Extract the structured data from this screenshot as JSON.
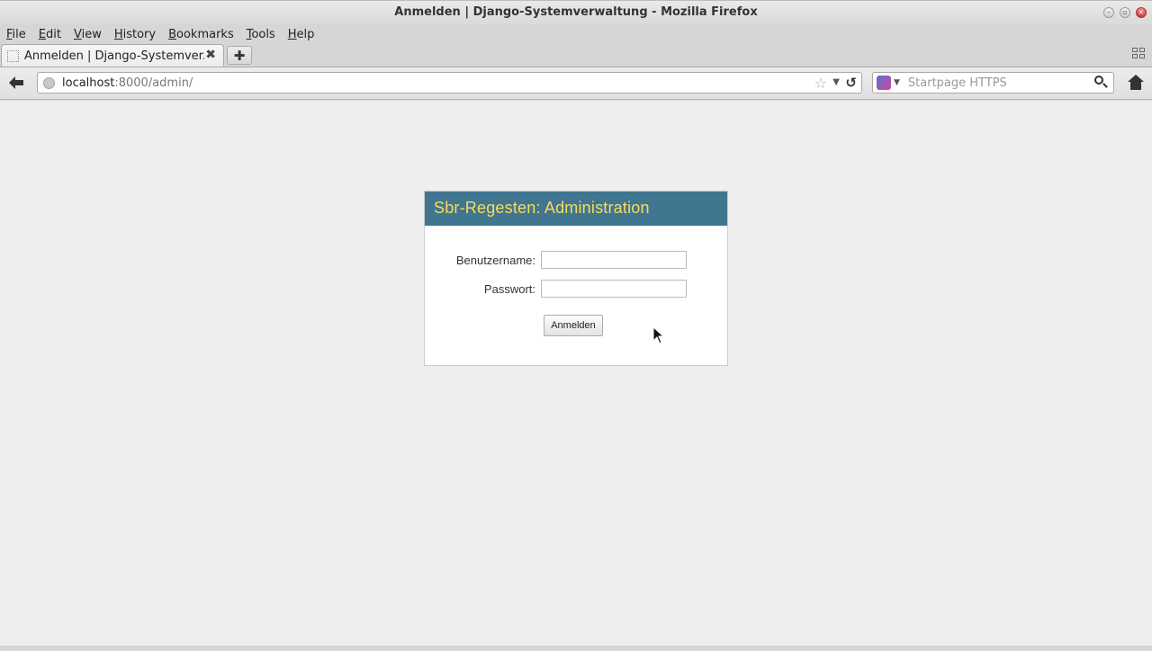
{
  "window": {
    "title": "Anmelden | Django-Systemverwaltung - Mozilla Firefox"
  },
  "menu": {
    "items": [
      "File",
      "Edit",
      "View",
      "History",
      "Bookmarks",
      "Tools",
      "Help"
    ]
  },
  "tabs": [
    {
      "label": "Anmelden | Django-Systemver...",
      "active": true
    }
  ],
  "navbar": {
    "url_host": "localhost",
    "url_rest": ":8000/admin/",
    "search_placeholder": "Startpage HTTPS"
  },
  "page": {
    "header": "Sbr-Regesten: Administration",
    "username_label": "Benutzername:",
    "username_value": "",
    "password_label": "Passwort:",
    "password_value": "",
    "submit_label": "Anmelden"
  },
  "colors": {
    "header_bg": "#417690",
    "header_text": "#f5dd5d",
    "page_bg": "#eeeeee"
  }
}
